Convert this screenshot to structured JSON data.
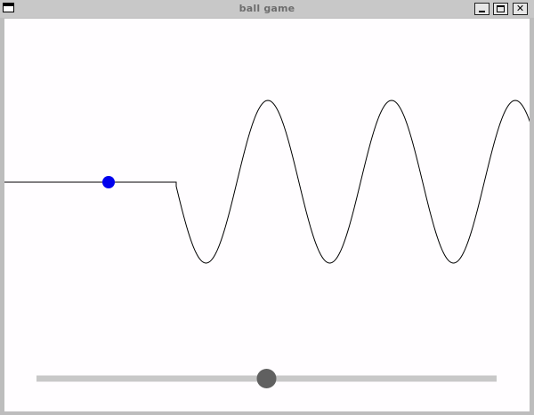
{
  "window": {
    "title": "ball game",
    "controls": {
      "minimize_icon": "minimize-icon",
      "maximize_icon": "maximize-icon",
      "close_icon": "close-icon",
      "close_glyph": "✕"
    }
  },
  "game": {
    "background_color": "#fffdff",
    "track": {
      "stroke_color": "#000000"
    },
    "ball": {
      "color": "#0000ee"
    },
    "slider": {
      "track_color": "#c8c8c8",
      "knob_color": "#606060",
      "value_fraction": 0.5
    }
  }
}
